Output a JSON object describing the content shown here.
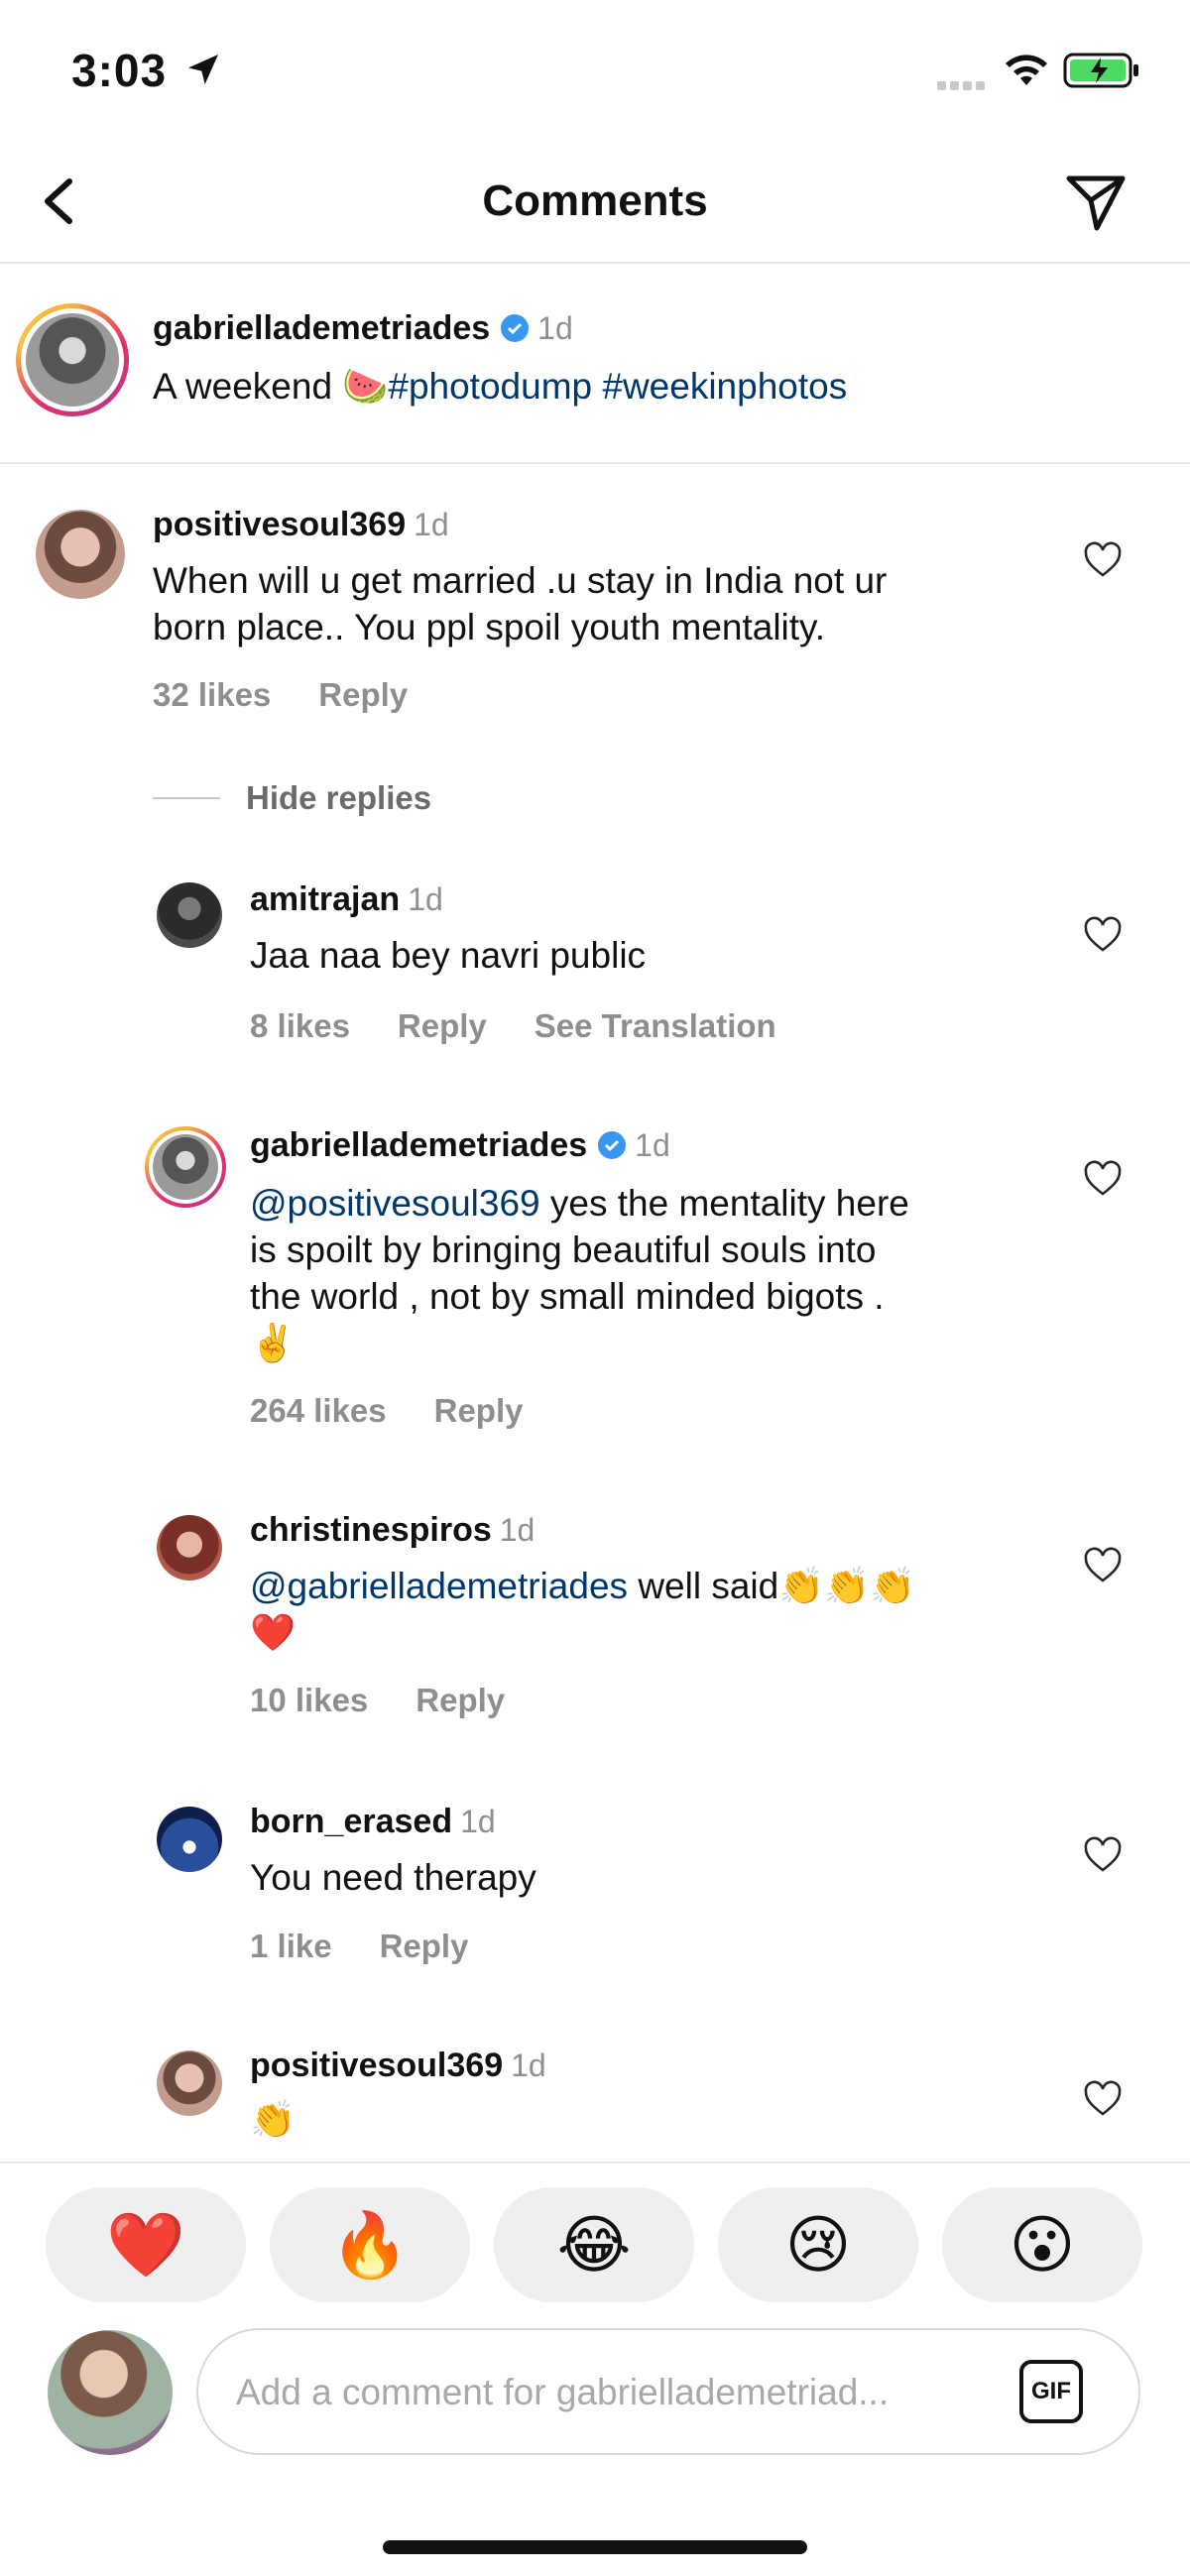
{
  "status_bar": {
    "time": "3:03"
  },
  "header": {
    "title": "Comments"
  },
  "post": {
    "username": "gabriellademetriades",
    "time": "1d",
    "caption_text": "A weekend 🍉",
    "hashtags": "#photodump #weekinphotos"
  },
  "comments": [
    {
      "username": "positivesoul369",
      "time": "1d",
      "line1": "When will u get married .u stay in India not ur",
      "line2": "born place.. You ppl spoil youth mentality.",
      "likes": "32 likes",
      "reply": "Reply",
      "hide_replies": "Hide replies"
    }
  ],
  "replies": [
    {
      "username": "amitrajan",
      "time": "1d",
      "text": "Jaa naa bey navri public",
      "likes": "8 likes",
      "reply": "Reply",
      "translate": "See Translation"
    },
    {
      "username": "gabriellademetriades",
      "time": "1d",
      "mention": "@positivesoul369",
      "line1": " yes the mentality here",
      "line2": "is spoilt by bringing beautiful souls into",
      "line3": "the world , not by small minded bigots .",
      "line4": "✌️",
      "likes": "264 likes",
      "reply": "Reply"
    },
    {
      "username": "christinespiros",
      "time": "1d",
      "mention": "@gabriellademetriades",
      "line1": " well said👏👏👏",
      "line2": "❤️",
      "likes": "10 likes",
      "reply": "Reply"
    },
    {
      "username": "born_erased",
      "time": "1d",
      "text": "You need therapy",
      "likes": "1 like",
      "reply": "Reply"
    },
    {
      "username": "positivesoul369",
      "time": "1d",
      "text": "👏"
    }
  ],
  "reactions": [
    "❤️",
    "🔥",
    "😂",
    "😢",
    "😮"
  ],
  "comment_input": {
    "placeholder": "Add a comment for gabriellademetriad...",
    "gif_label": "GIF"
  },
  "icons": {
    "back": "chevron-left-icon",
    "send": "paper-plane-icon",
    "heart": "heart-outline-icon",
    "verified": "verified-badge-icon",
    "location": "location-arrow-icon",
    "wifi": "wifi-icon",
    "battery": "battery-charging-icon"
  },
  "colors": {
    "mention": "#00376b",
    "verified": "#3897f0",
    "meta": "#8e8e8e",
    "battery": "#4cd964"
  }
}
